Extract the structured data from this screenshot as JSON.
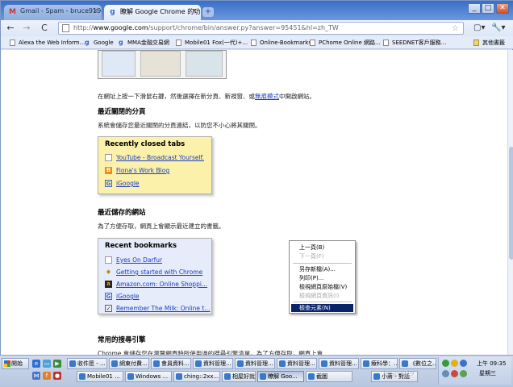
{
  "tabs": [
    {
      "title": "Gmail - Spam - bruce919@g",
      "icon": "gmail-icon"
    },
    {
      "title": "瞭解 Google Chrome 的功...",
      "icon": "google-icon"
    }
  ],
  "new_tab_glyph": "+",
  "window_controls": {
    "minimize": "_",
    "maximize": "□",
    "close": "✕"
  },
  "toolbar": {
    "back": "←",
    "forward": "→",
    "reload": "C",
    "url_prefix": "http://",
    "url_domain": "www.google.com",
    "url_rest": "/support/chrome/bin/answer.py?answer=95451&hl=zh_TW",
    "star": "☆",
    "page_menu": "▢▾",
    "tools_menu": "🔧▾"
  },
  "bookmarks": [
    {
      "label": "Alexa the Web Inform...",
      "icon": "page"
    },
    {
      "label": "Google",
      "icon": "google"
    },
    {
      "label": "MMA金融交易網",
      "icon": "google"
    },
    {
      "label": "Mobile01 Fox(一代)+...",
      "icon": "page"
    },
    {
      "label": "Online-Bookmarks",
      "icon": "page"
    },
    {
      "label": "PChome Online 網路...",
      "icon": "page"
    },
    {
      "label": "SEEDNET客戶服務...",
      "icon": "page"
    }
  ],
  "other_bookmarks": "其他書籤",
  "content": {
    "para1_before": "在網址上按一下滑鼠右鍵，然後選擇在新分頁、新視窗、或",
    "para1_link": "無痕模式",
    "para1_after": "中開啟網站。",
    "heading1": "最近關閉的分頁",
    "para2": "系統會儲存您最近關閉的分頁連結，以防您不小心將其關閉。",
    "recent_tabs_title": "Recently closed tabs",
    "recent_tabs": [
      {
        "label": "YouTube - Broadcast Yourself.",
        "icon": "page-icon"
      },
      {
        "label": "Fiona's Work Blog",
        "icon": "blogger-icon"
      },
      {
        "label": "iGoogle",
        "icon": "igoogle-icon"
      }
    ],
    "heading2": "最近儲存的網站",
    "para3": "為了方便存取，網頁上會顯示最近建立的書籤。",
    "recent_bm_title": "Recent bookmarks",
    "recent_bookmarks": [
      {
        "label": "Eyes On Darfur",
        "icon": "page-icon"
      },
      {
        "label": "Getting started with Chrome",
        "icon": "bird-icon"
      },
      {
        "label": "Amazon.com: Online Shoppi...",
        "icon": "amazon-icon"
      },
      {
        "label": "iGoogle",
        "icon": "igoogle-icon"
      },
      {
        "label": "Remember The Milk: Online t...",
        "icon": "rtm-icon"
      }
    ],
    "heading3": "常用的搜尋引擎",
    "para4": "Chrome 會儲存您在瀏覽網頁時所使用過的搜尋引擎清單。為了方便存取，網頁上會"
  },
  "context_menu": [
    {
      "label": "上一頁(B)",
      "state": "normal"
    },
    {
      "label": "下一頁(F)",
      "state": "disabled"
    },
    {
      "label": "另存新檔(A)...",
      "state": "normal"
    },
    {
      "label": "列印(P)...",
      "state": "normal"
    },
    {
      "label": "檢視網頁原始檔(V)",
      "state": "normal"
    },
    {
      "label": "檢視網頁資訊(I)",
      "state": "disabled"
    },
    {
      "label": "檢查元素(N)",
      "state": "selected"
    }
  ],
  "taskbar": {
    "start": "開始",
    "row1": [
      {
        "label": "收件匣 - ..."
      },
      {
        "label": "網東付費..."
      },
      {
        "label": "會員資料..."
      },
      {
        "label": "資料管理..."
      },
      {
        "label": "資料管理..."
      },
      {
        "label": "資料管理..."
      },
      {
        "label": "資料管理..."
      },
      {
        "label": "療科學：..."
      },
      {
        "label": "《數位之..."
      }
    ],
    "row2": [
      {
        "label": "Mobile01 ..."
      },
      {
        "label": "Windows ..."
      },
      {
        "label": "ching::2xx..."
      },
      {
        "label": "相屋好就..."
      },
      {
        "label": "瞭解 Goo...",
        "active": true
      },
      {
        "label": "截圖"
      },
      {
        "label": "小蔣 - 對話"
      }
    ],
    "time": "上午 09:35",
    "day": "星期三",
    "watermark": "bruce919"
  }
}
